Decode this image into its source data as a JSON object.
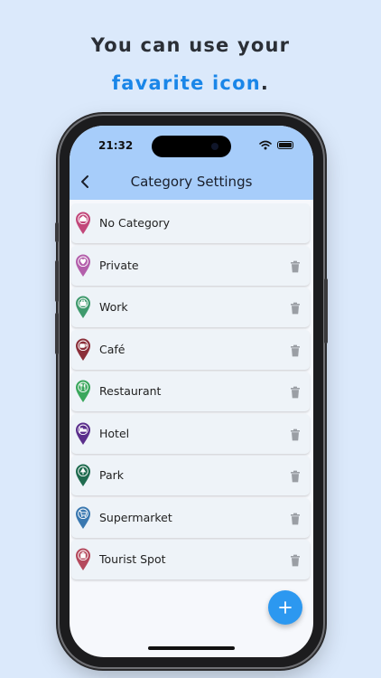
{
  "promo": {
    "line1": "You can use your",
    "line2": "favarite icon",
    "line2_end": "."
  },
  "status_bar": {
    "time": "21:32"
  },
  "header": {
    "title": "Category Settings"
  },
  "categories": [
    {
      "label": "No Category",
      "color": "#c2477a",
      "icon": "home-icon",
      "deletable": false
    },
    {
      "label": "Private",
      "color": "#b35fab",
      "icon": "heart-icon",
      "deletable": true
    },
    {
      "label": "Work",
      "color": "#3f9a6d",
      "icon": "briefcase-icon",
      "deletable": true
    },
    {
      "label": "Café",
      "color": "#8b2f3a",
      "icon": "coffee-icon",
      "deletable": true
    },
    {
      "label": "Restaurant",
      "color": "#3aa75c",
      "icon": "fork-knife-icon",
      "deletable": true
    },
    {
      "label": "Hotel",
      "color": "#5b2f8c",
      "icon": "bed-icon",
      "deletable": true
    },
    {
      "label": "Park",
      "color": "#1f6b4f",
      "icon": "tree-icon",
      "deletable": true
    },
    {
      "label": "Supermarket",
      "color": "#3a78b0",
      "icon": "cart-icon",
      "deletable": true
    },
    {
      "label": "Tourist Spot",
      "color": "#b4495d",
      "icon": "landmark-icon",
      "deletable": true
    }
  ],
  "colors": {
    "accent": "#1a86e8",
    "app_bar": "#a7cdfa",
    "fab": "#2c98f0",
    "background": "#dbe9fb"
  },
  "fab": {
    "icon": "plus-icon"
  }
}
